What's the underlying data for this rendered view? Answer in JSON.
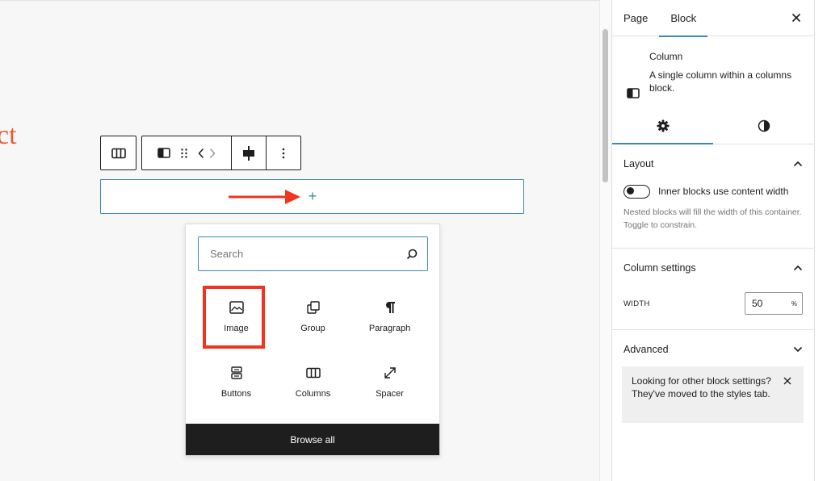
{
  "canvas": {
    "heading_fragment": "ct",
    "appender_plus": "+"
  },
  "toolbar": {
    "icons": [
      "columns-icon",
      "column-icon",
      "drag-handle-icon",
      "move-left-icon",
      "move-right-icon",
      "justify-center-icon",
      "more-options-icon"
    ]
  },
  "inserter": {
    "search": {
      "placeholder": "Search",
      "value": ""
    },
    "blocks": [
      {
        "label": "Image",
        "icon": "image-icon"
      },
      {
        "label": "Group",
        "icon": "group-icon"
      },
      {
        "label": "Paragraph",
        "icon": "paragraph-icon"
      },
      {
        "label": "Buttons",
        "icon": "buttons-icon"
      },
      {
        "label": "Columns",
        "icon": "columns-icon"
      },
      {
        "label": "Spacer",
        "icon": "spacer-icon"
      }
    ],
    "browse_all": "Browse all"
  },
  "sidebar": {
    "tabs": [
      {
        "label": "Page",
        "active": false
      },
      {
        "label": "Block",
        "active": true
      }
    ],
    "block_card": {
      "title": "Column",
      "description": "A single column within a columns block."
    },
    "sub_tabs": [
      "settings-icon",
      "styles-icon"
    ],
    "layout": {
      "title": "Layout",
      "toggle_label": "Inner blocks use content width",
      "toggle_on": false,
      "help": "Nested blocks will fill the width of this container. Toggle to constrain."
    },
    "column_settings": {
      "title": "Column settings",
      "width_label": "WIDTH",
      "width_value": "50",
      "width_unit": "%"
    },
    "advanced": {
      "title": "Advanced"
    },
    "notice": "Looking for other block settings? They've moved to the styles tab."
  },
  "colors": {
    "accent": "#3a8ab5",
    "highlight": "#f2331f",
    "heading": "#e35b34",
    "dark": "#1e1e1e"
  }
}
